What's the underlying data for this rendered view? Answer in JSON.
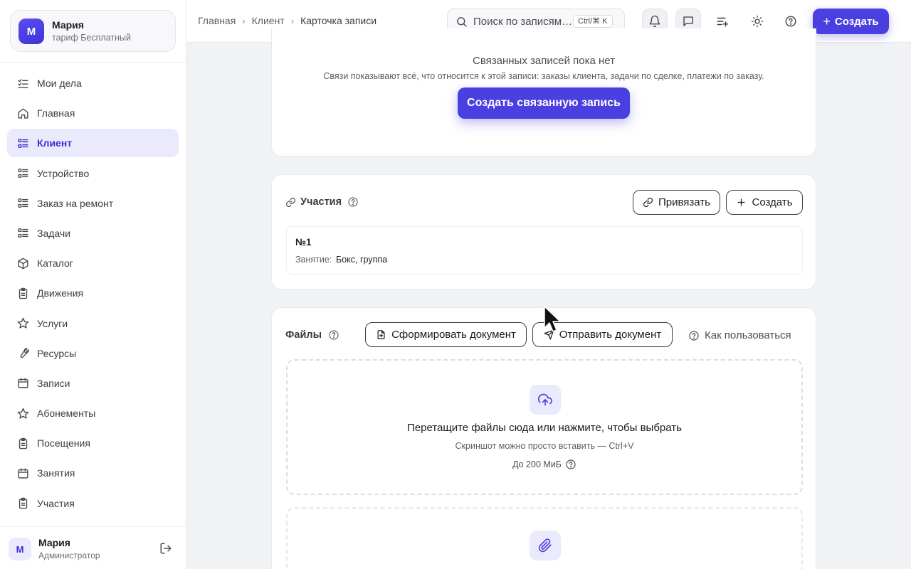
{
  "account": {
    "initial": "М",
    "name": "Мария",
    "plan": "тариф Бесплатный"
  },
  "sidebar": {
    "items": [
      {
        "label": "Мои дела",
        "icon": "checklist-icon"
      },
      {
        "label": "Главная",
        "icon": "home-icon"
      },
      {
        "label": "Клиент",
        "icon": "list-icon",
        "active": true
      },
      {
        "label": "Устройство",
        "icon": "list-icon"
      },
      {
        "label": "Заказ на ремонт",
        "icon": "list-icon"
      },
      {
        "label": "Задачи",
        "icon": "list-icon"
      },
      {
        "label": "Каталог",
        "icon": "box-icon"
      },
      {
        "label": "Движения",
        "icon": "clipboard-icon"
      },
      {
        "label": "Услуги",
        "icon": "star-icon"
      },
      {
        "label": "Ресурсы",
        "icon": "wrench-icon"
      },
      {
        "label": "Записи",
        "icon": "calendar-icon"
      },
      {
        "label": "Абонементы",
        "icon": "star-icon"
      },
      {
        "label": "Посещения",
        "icon": "clipboard-icon"
      },
      {
        "label": "Занятия",
        "icon": "calendar-icon"
      },
      {
        "label": "Участия",
        "icon": "clipboard-icon"
      }
    ]
  },
  "user": {
    "initial": "М",
    "name": "Мария",
    "role": "Администратор"
  },
  "header": {
    "breadcrumbs": [
      "Главная",
      "Клиент",
      "Карточка записи"
    ],
    "search_placeholder": "Поиск по записям…",
    "search_shortcut": "Ctrl/⌘ K",
    "create_label": "Создать"
  },
  "related": {
    "empty_title": "Связанных записей пока нет",
    "empty_desc": "Связи показывают всё, что относится к этой записи: заказы клиента, задачи по сделке, платежи по заказу.",
    "create_label": "Создать связанную запись"
  },
  "participation": {
    "title": "Участия",
    "link_label": "Привязать",
    "create_label": "Создать",
    "records": [
      {
        "number": "№1",
        "field_label": "Занятие:",
        "field_value": "Бокс, группа"
      }
    ]
  },
  "files": {
    "title": "Файлы",
    "generate_label": "Сформировать документ",
    "send_label": "Отправить документ",
    "howto_label": "Как пользоваться",
    "drop_title": "Перетащите файлы сюда или нажмите, чтобы выбрать",
    "drop_hint": "Скриншот можно просто вставить — Ctrl+V",
    "limit": "До 200 МиБ"
  },
  "colors": {
    "accent": "#4a3fe0",
    "accent_soft": "#ebeafd",
    "background": "#f1f2f4"
  }
}
